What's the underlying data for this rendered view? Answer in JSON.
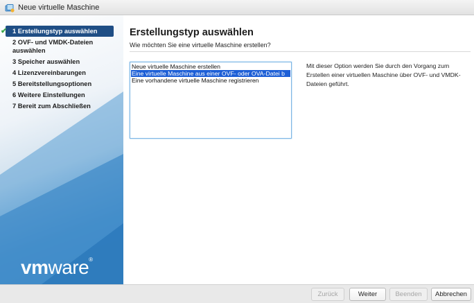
{
  "window": {
    "title": "Neue virtuelle Maschine",
    "icon": "vm-wizard-icon"
  },
  "sidebar": {
    "steps": [
      {
        "label": "1 Erstellungstyp auswählen",
        "active": true,
        "completed": true
      },
      {
        "label": "2 OVF- und VMDK-Dateien auswählen"
      },
      {
        "label": "3 Speicher auswählen"
      },
      {
        "label": "4 Lizenzvereinbarungen"
      },
      {
        "label": "5 Bereitstellungsoptionen"
      },
      {
        "label": "6 Weitere Einstellungen"
      },
      {
        "label": "7 Bereit zum Abschließen"
      }
    ],
    "logo": {
      "text_bold": "vm",
      "text": "ware",
      "registered": "®"
    }
  },
  "main": {
    "title": "Erstellungstyp auswählen",
    "subtitle": "Wie möchten Sie eine virtuelle Maschine erstellen?",
    "options": [
      {
        "label": "Neue virtuelle Maschine erstellen",
        "selected": false
      },
      {
        "label": "Eine virtuelle Maschine aus einer OVF- oder OVA-Datei b",
        "selected": true
      },
      {
        "label": "Eine vorhandene virtuelle Maschine registrieren",
        "selected": false
      }
    ],
    "description": "Mit dieser Option werden Sie durch den Vorgang zum Erstellen einer virtuellen Maschine über OVF- und VMDK-Dateien geführt."
  },
  "footer": {
    "back": "Zurück",
    "next": "Weiter",
    "finish": "Beenden",
    "cancel": "Abbrechen"
  },
  "colors": {
    "active_step": "#1f4e85",
    "selection": "#1d5fd6",
    "check": "#3aa648"
  }
}
